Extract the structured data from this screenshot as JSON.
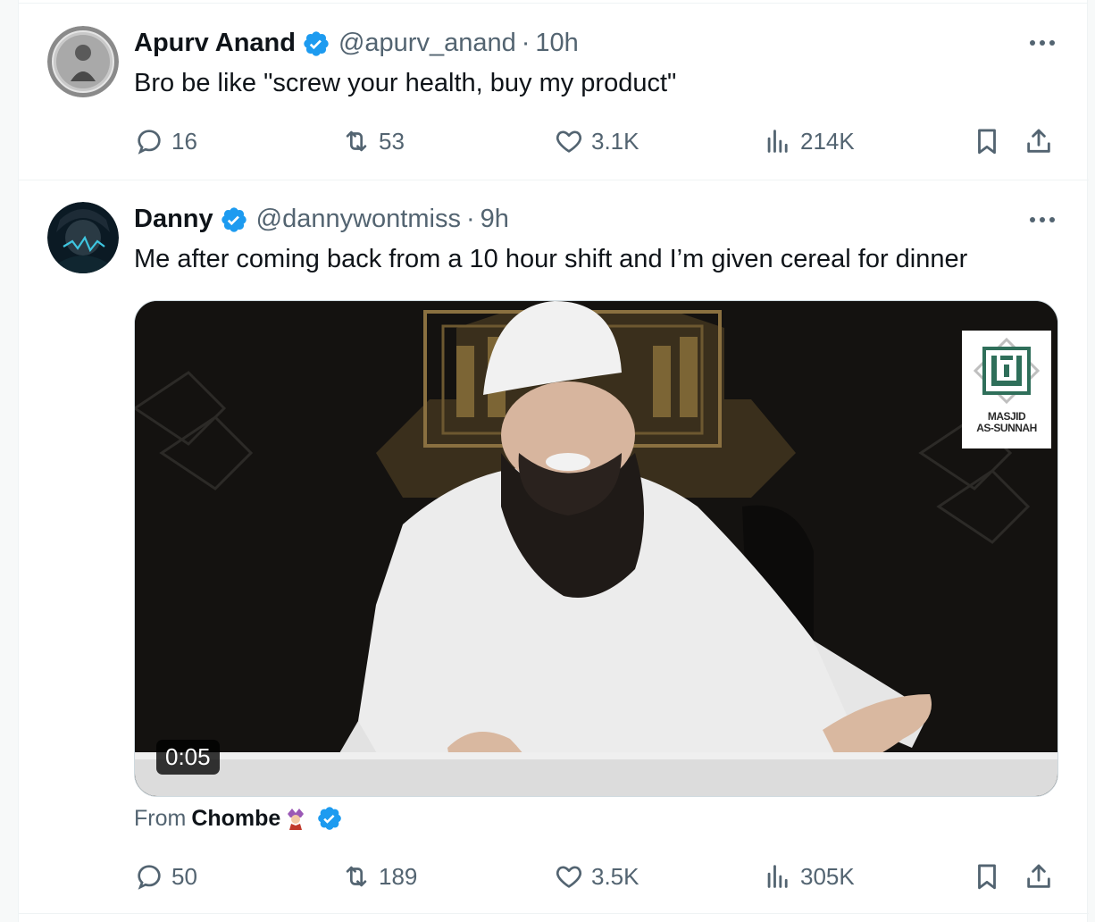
{
  "tweets": [
    {
      "name": "Apurv Anand",
      "handle": "@apurv_anand",
      "separator": "·",
      "time": "10h",
      "text": "Bro be like \"screw your health, buy my product\"",
      "stats": {
        "replies": "16",
        "retweets": "53",
        "likes": "3.1K",
        "views": "214K"
      }
    },
    {
      "name": "Danny",
      "handle": "@dannywontmiss",
      "separator": "·",
      "time": "9h",
      "text": "Me after coming back from a 10 hour shift and I’m given cereal for dinner",
      "media": {
        "duration": "0:05",
        "watermark": [
          "MASJID",
          "AS-SUNNAH"
        ]
      },
      "from": {
        "prefix": "From",
        "name": "Chombe"
      },
      "stats": {
        "replies": "50",
        "retweets": "189",
        "likes": "3.5K",
        "views": "305K"
      }
    }
  ],
  "icons": {
    "verified": "verified-badge-icon",
    "more": "more-dots-icon",
    "reply": "reply-bubble-icon",
    "retweet": "retweet-icon",
    "like": "heart-icon",
    "views": "views-bars-icon",
    "bookmark": "bookmark-icon",
    "share": "share-upload-icon"
  },
  "colors": {
    "verified": "#1d9bf0",
    "text": "#0f1419",
    "secondary": "#536471",
    "border": "#eff3f4"
  }
}
